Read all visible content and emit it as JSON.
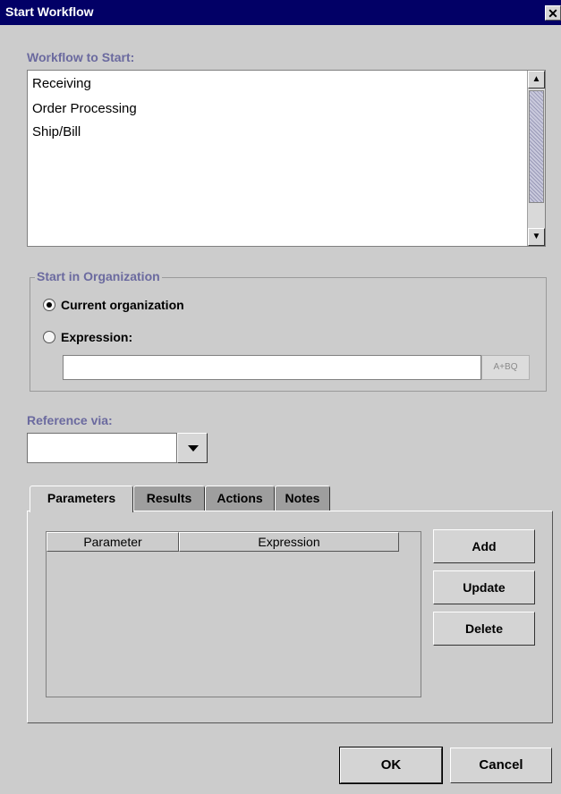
{
  "window": {
    "title": "Start Workflow",
    "close_glyph": "✕"
  },
  "workflow": {
    "label": "Workflow to Start:",
    "items": [
      "Receiving",
      "Order Processing",
      "Ship/Bill"
    ],
    "scroll_up_glyph": "▲",
    "scroll_down_glyph": "▼"
  },
  "organization": {
    "legend": "Start in Organization",
    "options": [
      {
        "label": "Current organization",
        "selected": true
      },
      {
        "label": "Expression:",
        "selected": false
      }
    ],
    "expression_value": "",
    "expression_button": "A+BQ"
  },
  "reference": {
    "label": "Reference via:",
    "value": ""
  },
  "tabs": [
    {
      "label": "Parameters",
      "active": true
    },
    {
      "label": "Results",
      "active": false
    },
    {
      "label": "Actions",
      "active": false
    },
    {
      "label": "Notes",
      "active": false
    }
  ],
  "parameters_table": {
    "columns": [
      "Parameter",
      "Expression"
    ],
    "rows": []
  },
  "side_buttons": {
    "add": "Add",
    "update": "Update",
    "delete": "Delete"
  },
  "footer": {
    "ok": "OK",
    "cancel": "Cancel"
  }
}
